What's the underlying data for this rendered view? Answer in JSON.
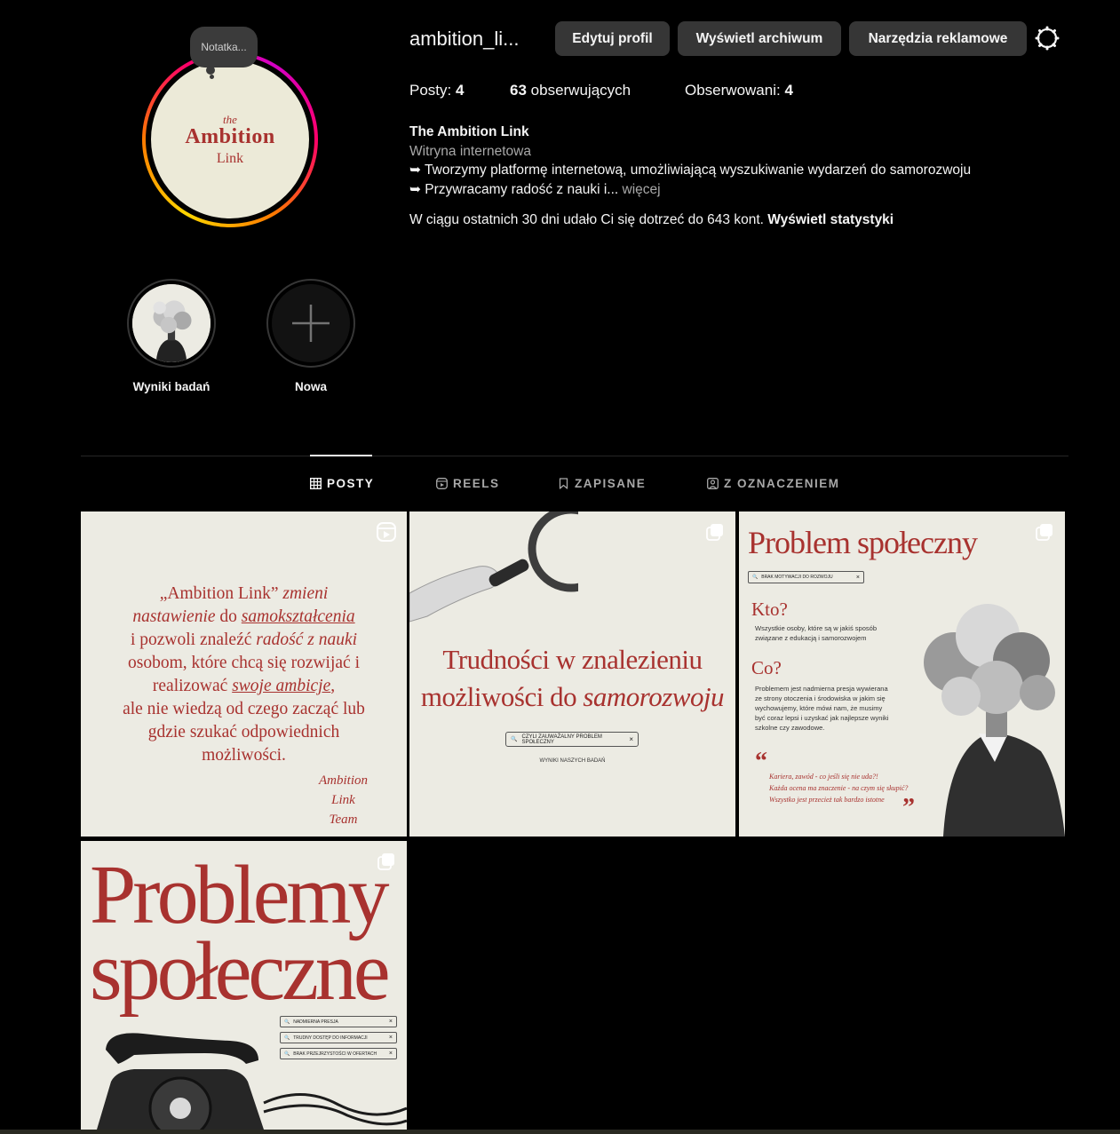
{
  "profile": {
    "note": "Notatka...",
    "avatar": {
      "the": "the",
      "name": "Ambition",
      "sub": "Link"
    },
    "username": "ambition_li...",
    "buttons": {
      "edit": "Edytuj profil",
      "archive": "Wyświetl archiwum",
      "ads": "Narzędzia reklamowe"
    },
    "stats": {
      "posts_label": "Posty:",
      "posts_value": "4",
      "followers_value": "63",
      "followers_label": "obserwujących",
      "following_label": "Obserwowani:",
      "following_value": "4"
    },
    "bio": {
      "name": "The Ambition Link",
      "category": "Witryna internetowa",
      "line1": "➥ Tworzymy platformę internetową, umożliwiającą wyszukiwanie wydarzeń do samorozwoju",
      "line2": "➥ Przywracamy radość z nauki i...",
      "more": "więcej"
    },
    "insight": {
      "text": "W ciągu ostatnich 30 dni udało Ci się dotrzeć do 643 kont.",
      "link": "Wyświetl statystyki"
    }
  },
  "highlights": [
    {
      "label": "Wyniki badań"
    },
    {
      "label": "Nowa"
    }
  ],
  "tabs": [
    {
      "label": "POSTY",
      "icon": "grid-icon",
      "active": true
    },
    {
      "label": "REELS",
      "icon": "reels-icon"
    },
    {
      "label": "ZAPISANE",
      "icon": "bookmark-icon"
    },
    {
      "label": "Z OZNACZENIEM",
      "icon": "tagged-icon"
    }
  ],
  "posts": {
    "p1": {
      "l1a": "„Ambition Link”",
      "l1b": "zmieni",
      "l2a": "nastawienie",
      "l2b": "do",
      "l2c": "samokształcenia",
      "l3a": "i pozwoli znaleźć",
      "l3b": "radość z nauki",
      "l4": "osobom, które chcą się rozwijać i",
      "l5a": "realizować",
      "l5b": "swoje ambicje",
      "l6": "ale nie wiedzą od czego zacząć lub",
      "l7": "gdzie szukać odpowiednich",
      "l8": "możliwości.",
      "sig1": "Ambition",
      "sig2": "Link",
      "sig3": "Team"
    },
    "p2": {
      "t1": "Trudności w znalezieniu",
      "t2a": "możliwości do",
      "t2b": "samorozwoju",
      "search": "CZYLI ZAUWAŻALNY PROBLEM SPOŁECZNY",
      "results": "WYNIKI NASZYCH BADAŃ"
    },
    "p3": {
      "title": "Problem społeczny",
      "search": "BRAK MOTYWACJI DO ROZWOJU",
      "who": "Kto?",
      "who_text": "Wszystkie osoby, które są w jakiś sposób związane z edukacją i samorozwojem",
      "what": "Co?",
      "what_text": "Problemem jest nadmierna presja wywierana ze strony otoczenia i środowiska w jakim się wychowujemy, które mówi nam, że musimy być coraz lepsi i uzyskać jak najlepsze wyniki szkolne czy zawodowe.",
      "q1": "Kariera, zawód - co jeśli się nie uda?!",
      "q2": "Każda ocena ma znaczenie - na czym się skupić?",
      "q3": "Wszystko jest przecież tak bardzo istotne"
    },
    "p4": {
      "t1": "Problemy",
      "t2": "społeczne",
      "tags": [
        "NADMIERNA PRESJA",
        "TRUDNY DOSTĘP DO INFORMACJI",
        "BRAK PRZEJRZYSTOŚCI W OFERTACH"
      ]
    }
  },
  "colors": {
    "accent": "#a8322f",
    "button_bg": "#363636",
    "post_bg": "#ecebe3"
  }
}
